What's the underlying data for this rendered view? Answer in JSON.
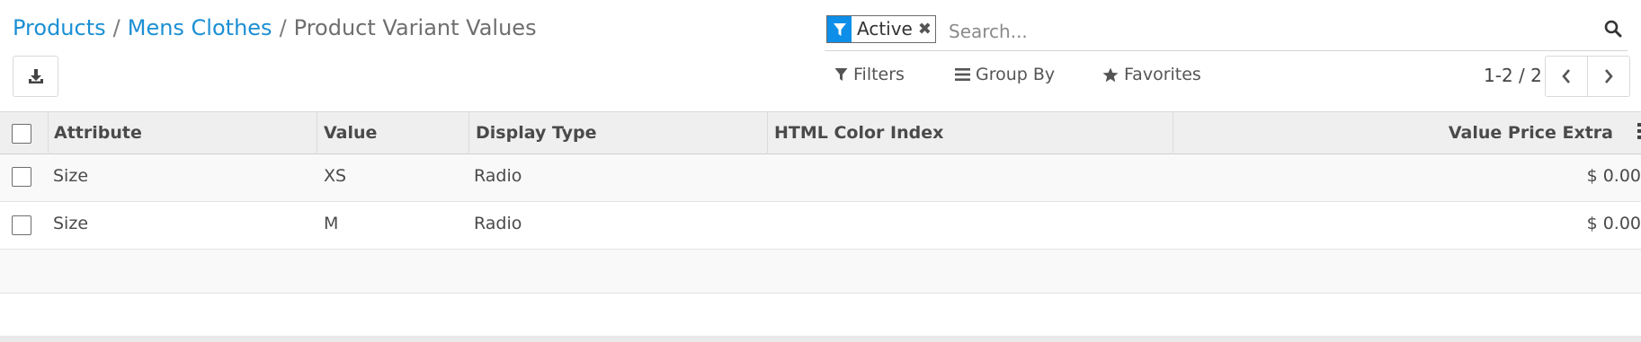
{
  "breadcrumb": {
    "items": [
      "Products",
      "Mens Clothes"
    ],
    "separator": "/",
    "current": "Product Variant Values"
  },
  "search": {
    "facet_label": "Active",
    "facet_remove": "✖",
    "placeholder": "Search..."
  },
  "menus": {
    "filters": "Filters",
    "group_by": "Group By",
    "favorites": "Favorites"
  },
  "pager": {
    "value": "1-2 / 2"
  },
  "table": {
    "headers": [
      "Attribute",
      "Value",
      "Display Type",
      "HTML Color Index",
      "Value Price Extra"
    ],
    "rows": [
      {
        "attribute": "Size",
        "value": "XS",
        "display_type": "Radio",
        "html_color_index": "",
        "price_extra": "$ 0.00"
      },
      {
        "attribute": "Size",
        "value": "M",
        "display_type": "Radio",
        "html_color_index": "",
        "price_extra": "$ 0.00"
      }
    ]
  },
  "icons": {
    "export": "download-icon",
    "facet": "filter-icon",
    "search": "search-icon",
    "filters": "filter-icon",
    "group_by": "list-icon",
    "favorites": "star-icon",
    "prev": "chevron-left-icon",
    "next": "chevron-right-icon"
  },
  "colors": {
    "accent": "#1b8fd4",
    "facet_icon_bg": "#0d8ee8"
  }
}
